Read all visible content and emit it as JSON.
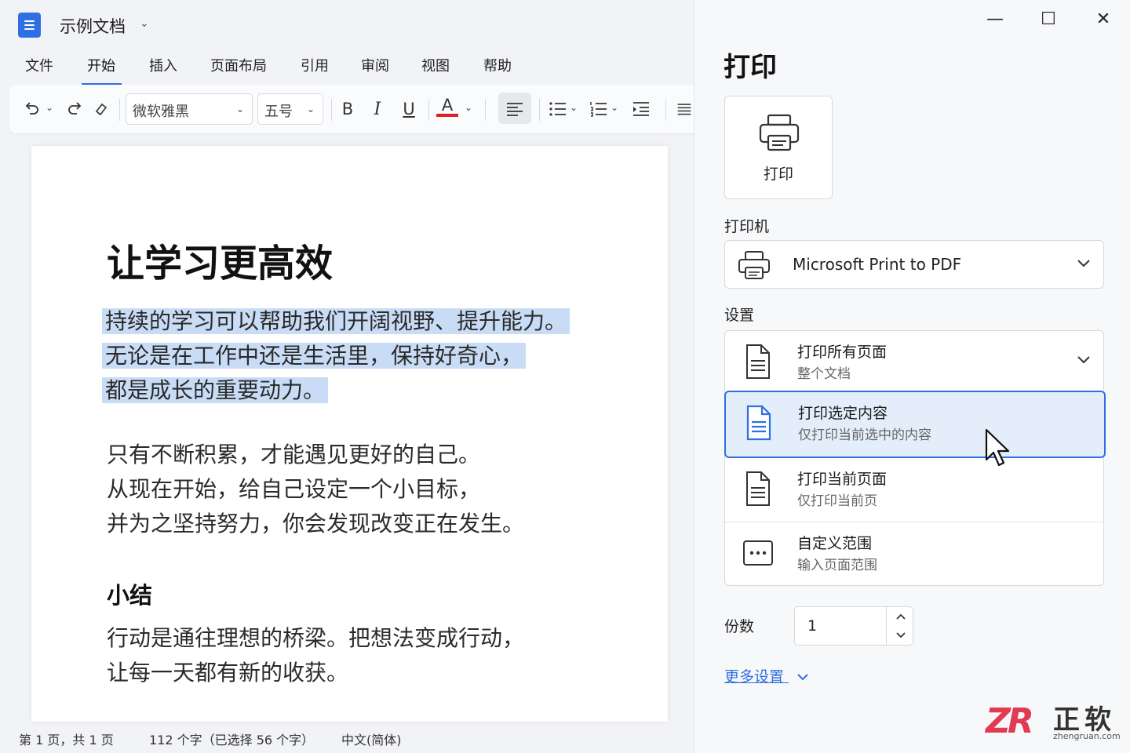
{
  "window": {
    "title": "示例文档",
    "title_chevron": "⌄",
    "minimize": "—",
    "maximize": "☐",
    "close": "✕"
  },
  "menu": {
    "items": [
      "文件",
      "开始",
      "插入",
      "页面布局",
      "引用",
      "审阅",
      "视图",
      "帮助"
    ],
    "active": "开始"
  },
  "toolbar": {
    "font_name": "微软雅黑",
    "font_size": "五号",
    "bold": "B",
    "italic": "I",
    "underline": "U",
    "font_color_glyph": "A",
    "font_color": "#e02020"
  },
  "document": {
    "heading": "让学习更高效",
    "para1_selected": [
      "持续的学习可以帮助我们开阔视野、提升能力。",
      "无论是在工作中还是生活里，保持好奇心，",
      "都是成长的重要动力。"
    ],
    "para2": [
      "只有不断积累，才能遇见更好的自己。",
      "从现在开始，给自己设定一个小目标，",
      "并为之坚持努力，你会发现改变正在发生。"
    ],
    "subheading": "小结",
    "para3": [
      "行动是通往理想的桥梁。把想法变成行动，",
      "让每一天都有新的收获。"
    ]
  },
  "status": {
    "page": "第 1 页，共 1 页",
    "words": "112 个字（已选择 56 个字）",
    "language": "中文(简体)"
  },
  "print_pane": {
    "title": "打印",
    "print_button_label": "打印",
    "printer_label": "打印机",
    "printer_name": "Microsoft Print to PDF",
    "settings_label": "设置",
    "range_options": [
      {
        "title": "打印所有页面",
        "subtitle": "整个文档"
      },
      {
        "title": "打印选定内容",
        "subtitle": "仅打印当前选中的内容"
      },
      {
        "title": "打印当前页面",
        "subtitle": "仅打印当前页"
      },
      {
        "title": "自定义范围",
        "subtitle": "输入页面范围"
      }
    ],
    "selected_option": "打印选定内容",
    "copies_label": "份数",
    "copies_value": "1",
    "more_settings": "更多设置"
  },
  "watermark": {
    "mark": "ZR",
    "brand": "正软",
    "url": "zhengruan.com"
  },
  "colors": {
    "accent": "#2f6fe4",
    "selection": "#c9dcf6",
    "selected_option_bg": "#e4eefb"
  }
}
